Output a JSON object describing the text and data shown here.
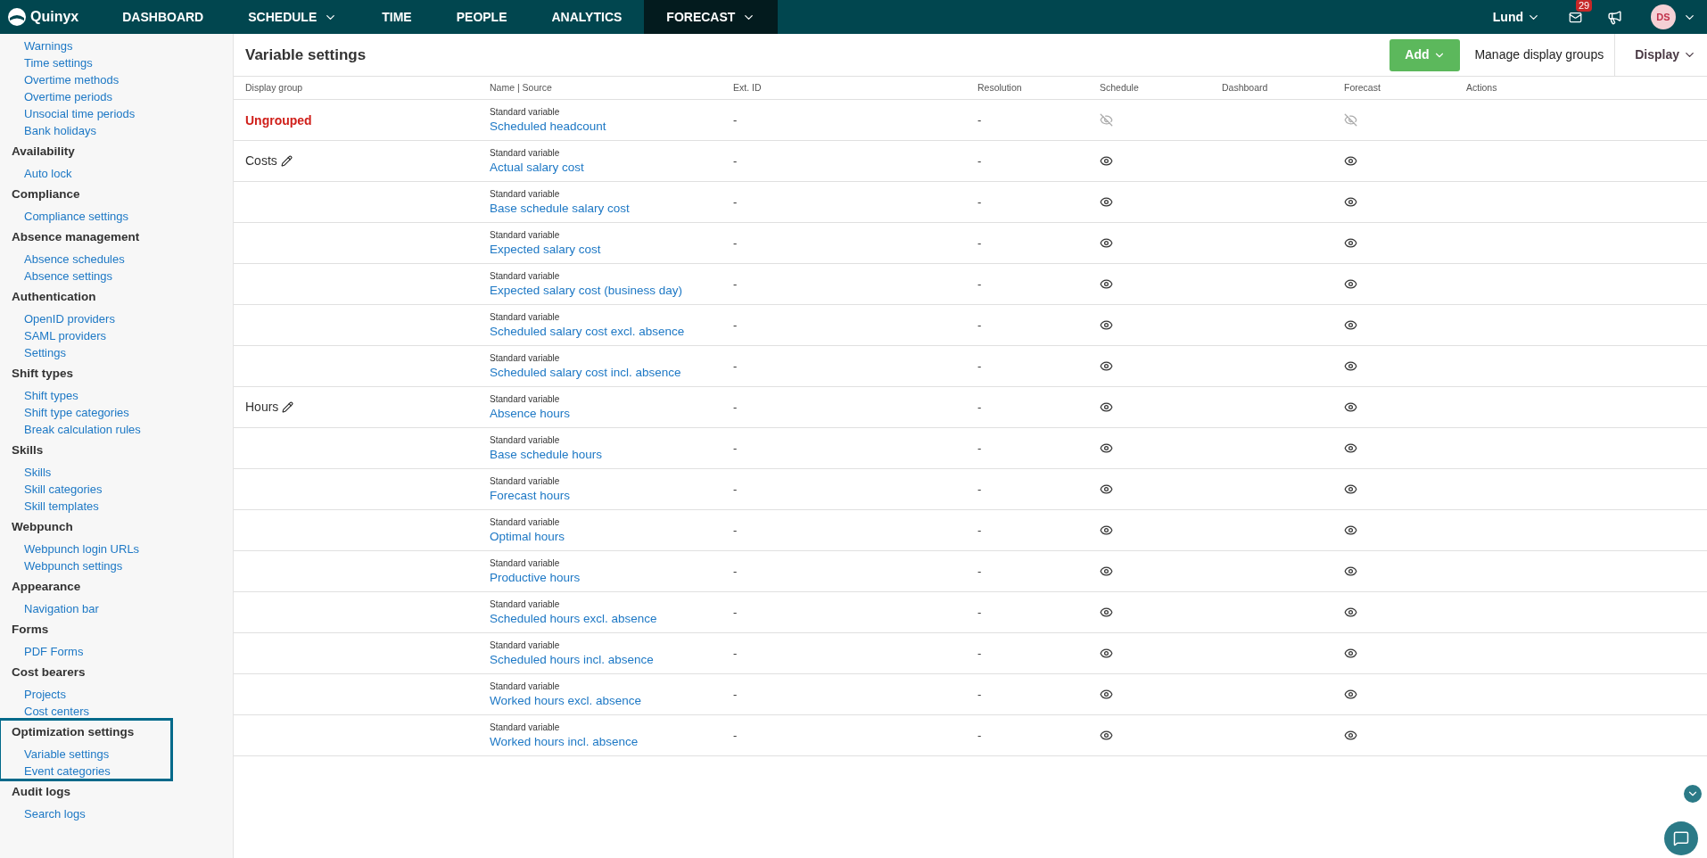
{
  "topbar": {
    "logo": "Quinyx",
    "nav": [
      {
        "label": "DASHBOARD",
        "selected": false,
        "dropdown": false
      },
      {
        "label": "SCHEDULE",
        "selected": false,
        "dropdown": true
      },
      {
        "label": "TIME",
        "selected": false,
        "dropdown": false
      },
      {
        "label": "PEOPLE",
        "selected": false,
        "dropdown": false
      },
      {
        "label": "ANALYTICS",
        "selected": false,
        "dropdown": false
      },
      {
        "label": "FORECAST",
        "selected": true,
        "dropdown": true
      }
    ],
    "unit": "Lund",
    "mail_count": "29",
    "avatar": "DS"
  },
  "sidebar": {
    "sections": [
      {
        "items": [
          "Warnings",
          "Time settings",
          "Overtime methods",
          "Overtime periods",
          "Unsocial time periods",
          "Bank holidays"
        ],
        "highlighted": false
      },
      {
        "title": "Availability",
        "items": [
          "Auto lock"
        ],
        "highlighted": false
      },
      {
        "title": "Compliance",
        "items": [
          "Compliance settings"
        ],
        "highlighted": false
      },
      {
        "title": "Absence management",
        "items": [
          "Absence schedules",
          "Absence settings"
        ],
        "highlighted": false
      },
      {
        "title": "Authentication",
        "items": [
          "OpenID providers",
          "SAML providers",
          "Settings"
        ],
        "highlighted": false
      },
      {
        "title": "Shift types",
        "items": [
          "Shift types",
          "Shift type categories",
          "Break calculation rules"
        ],
        "highlighted": false
      },
      {
        "title": "Skills",
        "items": [
          "Skills",
          "Skill categories",
          "Skill templates"
        ],
        "highlighted": false
      },
      {
        "title": "Webpunch",
        "items": [
          "Webpunch login URLs",
          "Webpunch settings"
        ],
        "highlighted": false
      },
      {
        "title": "Appearance",
        "items": [
          "Navigation bar"
        ],
        "highlighted": false
      },
      {
        "title": "Forms",
        "items": [
          "PDF Forms"
        ],
        "highlighted": false
      },
      {
        "title": "Cost bearers",
        "items": [
          "Projects",
          "Cost centers"
        ],
        "highlighted": false
      },
      {
        "title": "Optimization settings",
        "items": [
          "Variable settings",
          "Event categories"
        ],
        "highlighted": true
      },
      {
        "title": "Audit logs",
        "items": [
          "Search logs"
        ],
        "highlighted": false
      }
    ]
  },
  "page": {
    "title": "Variable settings",
    "add_button": "Add",
    "manage_button": "Manage display groups",
    "display_button": "Display"
  },
  "table": {
    "columns": [
      "Display group",
      "Name | Source",
      "Ext. ID",
      "Resolution",
      "Schedule",
      "Dashboard",
      "Forecast",
      "Actions"
    ],
    "rows": [
      {
        "group": {
          "label": "Ungrouped",
          "kind": "ungrouped"
        },
        "source": "Standard variable",
        "name": "Scheduled headcount",
        "ext_id": "-",
        "resolution": "-",
        "schedule_visible": false,
        "forecast_visible": false
      },
      {
        "group": {
          "label": "Costs",
          "kind": "editable"
        },
        "source": "Standard variable",
        "name": "Actual salary cost",
        "ext_id": "-",
        "resolution": "-",
        "schedule_visible": true,
        "forecast_visible": true
      },
      {
        "source": "Standard variable",
        "name": "Base schedule salary cost",
        "ext_id": "-",
        "resolution": "-",
        "schedule_visible": true,
        "forecast_visible": true
      },
      {
        "source": "Standard variable",
        "name": "Expected salary cost",
        "ext_id": "-",
        "resolution": "-",
        "schedule_visible": true,
        "forecast_visible": true
      },
      {
        "source": "Standard variable",
        "name": "Expected salary cost (business day)",
        "ext_id": "-",
        "resolution": "-",
        "schedule_visible": true,
        "forecast_visible": true
      },
      {
        "source": "Standard variable",
        "name": "Scheduled salary cost excl. absence",
        "ext_id": "-",
        "resolution": "-",
        "schedule_visible": true,
        "forecast_visible": true
      },
      {
        "source": "Standard variable",
        "name": "Scheduled salary cost incl. absence",
        "ext_id": "-",
        "resolution": "-",
        "schedule_visible": true,
        "forecast_visible": true
      },
      {
        "group": {
          "label": "Hours",
          "kind": "editable"
        },
        "source": "Standard variable",
        "name": "Absence hours",
        "ext_id": "-",
        "resolution": "-",
        "schedule_visible": true,
        "forecast_visible": true
      },
      {
        "source": "Standard variable",
        "name": "Base schedule hours",
        "ext_id": "-",
        "resolution": "-",
        "schedule_visible": true,
        "forecast_visible": true
      },
      {
        "source": "Standard variable",
        "name": "Forecast hours",
        "ext_id": "-",
        "resolution": "-",
        "schedule_visible": true,
        "forecast_visible": true
      },
      {
        "source": "Standard variable",
        "name": "Optimal hours",
        "ext_id": "-",
        "resolution": "-",
        "schedule_visible": true,
        "forecast_visible": true
      },
      {
        "source": "Standard variable",
        "name": "Productive hours",
        "ext_id": "-",
        "resolution": "-",
        "schedule_visible": true,
        "forecast_visible": true
      },
      {
        "source": "Standard variable",
        "name": "Scheduled hours excl. absence",
        "ext_id": "-",
        "resolution": "-",
        "schedule_visible": true,
        "forecast_visible": true
      },
      {
        "source": "Standard variable",
        "name": "Scheduled hours incl. absence",
        "ext_id": "-",
        "resolution": "-",
        "schedule_visible": true,
        "forecast_visible": true
      },
      {
        "source": "Standard variable",
        "name": "Worked hours excl. absence",
        "ext_id": "-",
        "resolution": "-",
        "schedule_visible": true,
        "forecast_visible": true
      },
      {
        "source": "Standard variable",
        "name": "Worked hours incl. absence",
        "ext_id": "-",
        "resolution": "-",
        "schedule_visible": true,
        "forecast_visible": true
      }
    ]
  }
}
